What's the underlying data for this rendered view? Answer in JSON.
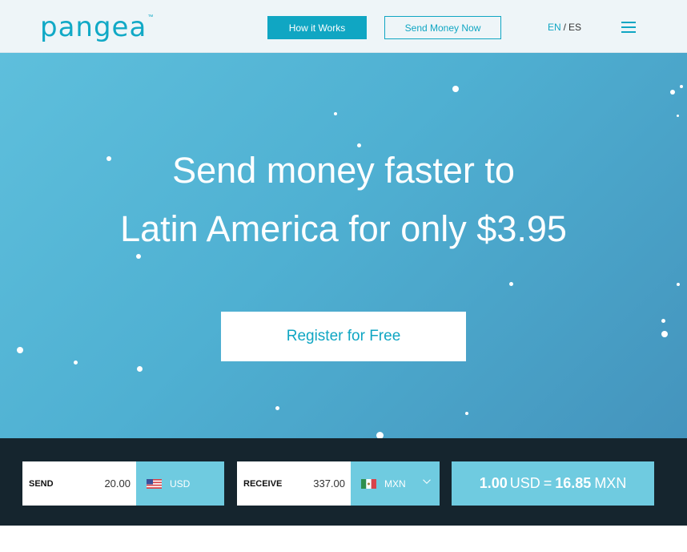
{
  "header": {
    "logo_text": "pangea",
    "logo_tm": "™",
    "how_it_works": "How it Works",
    "send_money_now": "Send Money Now",
    "lang_en": "EN",
    "lang_sep": "/",
    "lang_es": "ES",
    "menu_icon": "hamburger-menu-icon"
  },
  "hero": {
    "headline_line1": "Send money faster to",
    "headline_line2": "Latin America for only $3.95",
    "register_button": "Register for Free"
  },
  "calculator": {
    "send_label": "SEND",
    "send_amount": "20.00",
    "send_currency": "USD",
    "send_flag": "us-flag-icon",
    "receive_label": "RECEIVE",
    "receive_amount": "337.00",
    "receive_currency": "MXN",
    "receive_flag": "mx-flag-icon",
    "dropdown_icon": "chevron-down-icon",
    "rate_from_value": "1.00",
    "rate_from_currency": "USD",
    "rate_equals": "=",
    "rate_to_value": "16.85",
    "rate_to_currency": "MXN"
  },
  "colors": {
    "brand": "#10a6c3",
    "hero_gradient_start": "#5ebfdc",
    "hero_gradient_end": "#4494bd",
    "calc_bar_bg": "#15252e",
    "calc_accent": "#6fcbe0"
  }
}
